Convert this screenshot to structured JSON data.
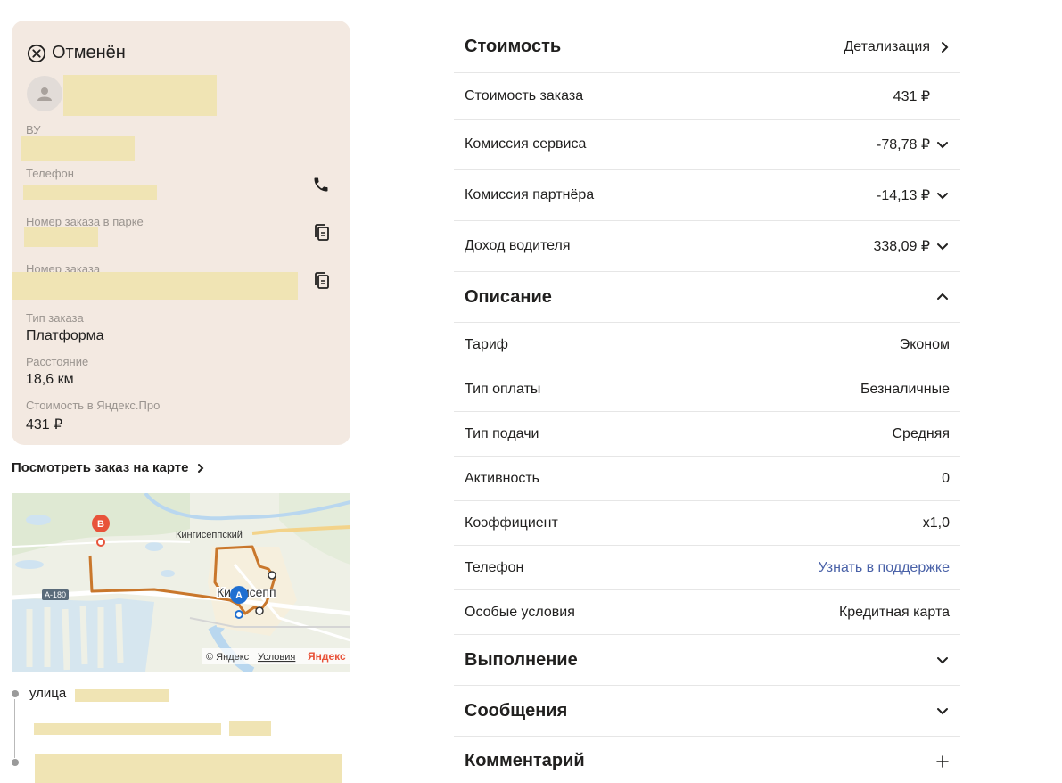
{
  "order_card": {
    "status": "Отменён",
    "labels": {
      "vu": "ВУ",
      "phone": "Телефон",
      "park_order_number": "Номер заказа в парке",
      "order_number": "Номер заказа",
      "order_type": "Тип заказа",
      "distance": "Расстояние",
      "cost_yandex_pro": "Стоимость в Яндекс.Про"
    },
    "values": {
      "order_type": "Платформа",
      "distance": "18,6 км",
      "cost_yandex_pro": "431 ₽"
    }
  },
  "map": {
    "link_label": "Посмотреть заказ на карте",
    "road_label": "A-180",
    "place_label_1": "Кингисеппский",
    "place_label_2": "Кингисепп",
    "point_a": "A",
    "point_b": "B",
    "attribution_copy": "© Яндекс",
    "attribution_terms": "Условия",
    "attribution_brand": "Яндекс"
  },
  "route": {
    "street_prefix": "улица"
  },
  "cost_section": {
    "title": "Стоимость",
    "details_link": "Детализация",
    "rows": [
      {
        "label": "Стоимость заказа",
        "value": "431 ₽",
        "expandable": false
      },
      {
        "label": "Комиссия сервиса",
        "value": "-78,78 ₽",
        "expandable": true
      },
      {
        "label": "Комиссия партнёра",
        "value": "-14,13 ₽",
        "expandable": true
      },
      {
        "label": "Доход водителя",
        "value": "338,09 ₽",
        "expandable": true
      }
    ]
  },
  "description_section": {
    "title": "Описание",
    "rows": [
      {
        "label": "Тариф",
        "value": "Эконом"
      },
      {
        "label": "Тип оплаты",
        "value": "Безналичные"
      },
      {
        "label": "Тип подачи",
        "value": "Средняя"
      },
      {
        "label": "Активность",
        "value": "0"
      },
      {
        "label": "Коэффициент",
        "value": "x1,0"
      },
      {
        "label": "Телефон",
        "value": "Узнать в поддержке"
      },
      {
        "label": "Особые условия",
        "value": "Кредитная карта"
      }
    ]
  },
  "execution_section": {
    "title": "Выполнение"
  },
  "messages_section": {
    "title": "Сообщения"
  },
  "comment_section": {
    "title": "Комментарий"
  },
  "colors": {
    "card_bg": "#f3e9e1",
    "redaction": "#f0e4b4",
    "link": "#4a62a8",
    "route_line": "#c9772c",
    "point_a": "#1f6fd1",
    "point_b": "#e8533a"
  }
}
